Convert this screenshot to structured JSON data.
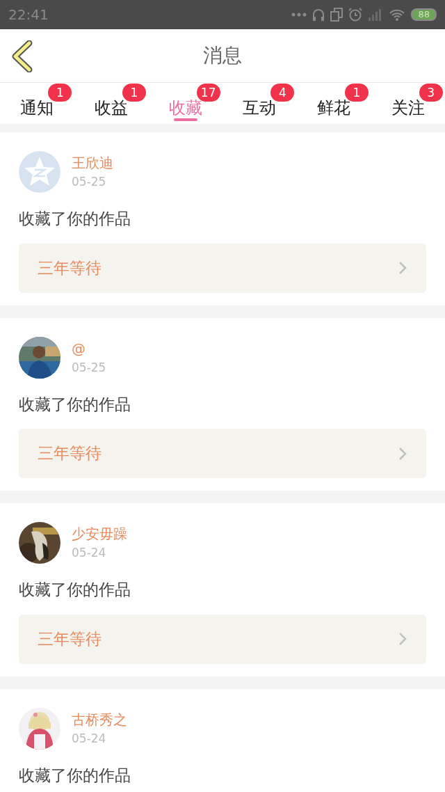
{
  "status_bar": {
    "time": "22:41",
    "battery": "88"
  },
  "header": {
    "title": "消息"
  },
  "tabs": [
    {
      "label": "通知",
      "badge": "1",
      "selected": false
    },
    {
      "label": "收益",
      "badge": "1",
      "selected": false
    },
    {
      "label": "收藏",
      "badge": "17",
      "selected": true
    },
    {
      "label": "互动",
      "badge": "4",
      "selected": false
    },
    {
      "label": "鲜花",
      "badge": "1",
      "selected": false
    },
    {
      "label": "关注",
      "badge": "3",
      "selected": false
    }
  ],
  "messages": [
    {
      "avatar": {
        "kind": "default"
      },
      "name": "王欣迪",
      "date": "05-25",
      "text": "收藏了你的作品",
      "work": "三年等待"
    },
    {
      "name": "@",
      "date": "05-25",
      "text": "收藏了你的作品",
      "work": "三年等待"
    },
    {
      "name": "少安毋躁",
      "date": "05-24",
      "text": "收藏了你的作品",
      "work": "三年等待"
    },
    {
      "name": "古桥秀之",
      "date": "05-24",
      "text": "收藏了你的作品"
    }
  ]
}
